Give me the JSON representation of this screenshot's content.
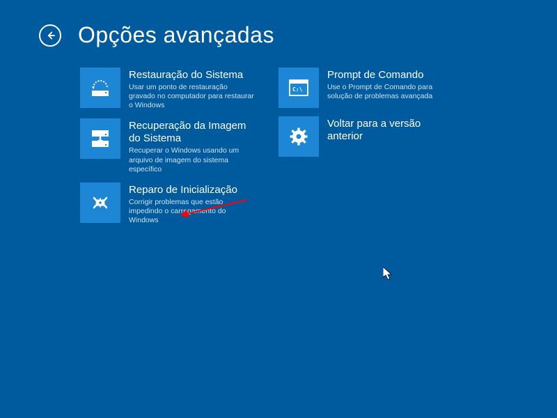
{
  "header": {
    "title": "Opções avançadas"
  },
  "tiles": {
    "system_restore": {
      "title": "Restauração do Sistema",
      "desc": "Usar um ponto de restauração gravado no computador para restaurar o Windows"
    },
    "system_image_recovery": {
      "title": "Recuperação da Imagem do Sistema",
      "desc": "Recuperar o Windows usando um arquivo de imagem do sistema específico"
    },
    "startup_repair": {
      "title": "Reparo de Inicialização",
      "desc": "Corrigir problemas que estão impedindo o carregamento do Windows"
    },
    "command_prompt": {
      "title": "Prompt de Comando",
      "desc": "Use o Prompt de Comando para solução de problemas avançada"
    },
    "previous_version": {
      "title": "Voltar para a versão anterior",
      "desc": ""
    }
  }
}
